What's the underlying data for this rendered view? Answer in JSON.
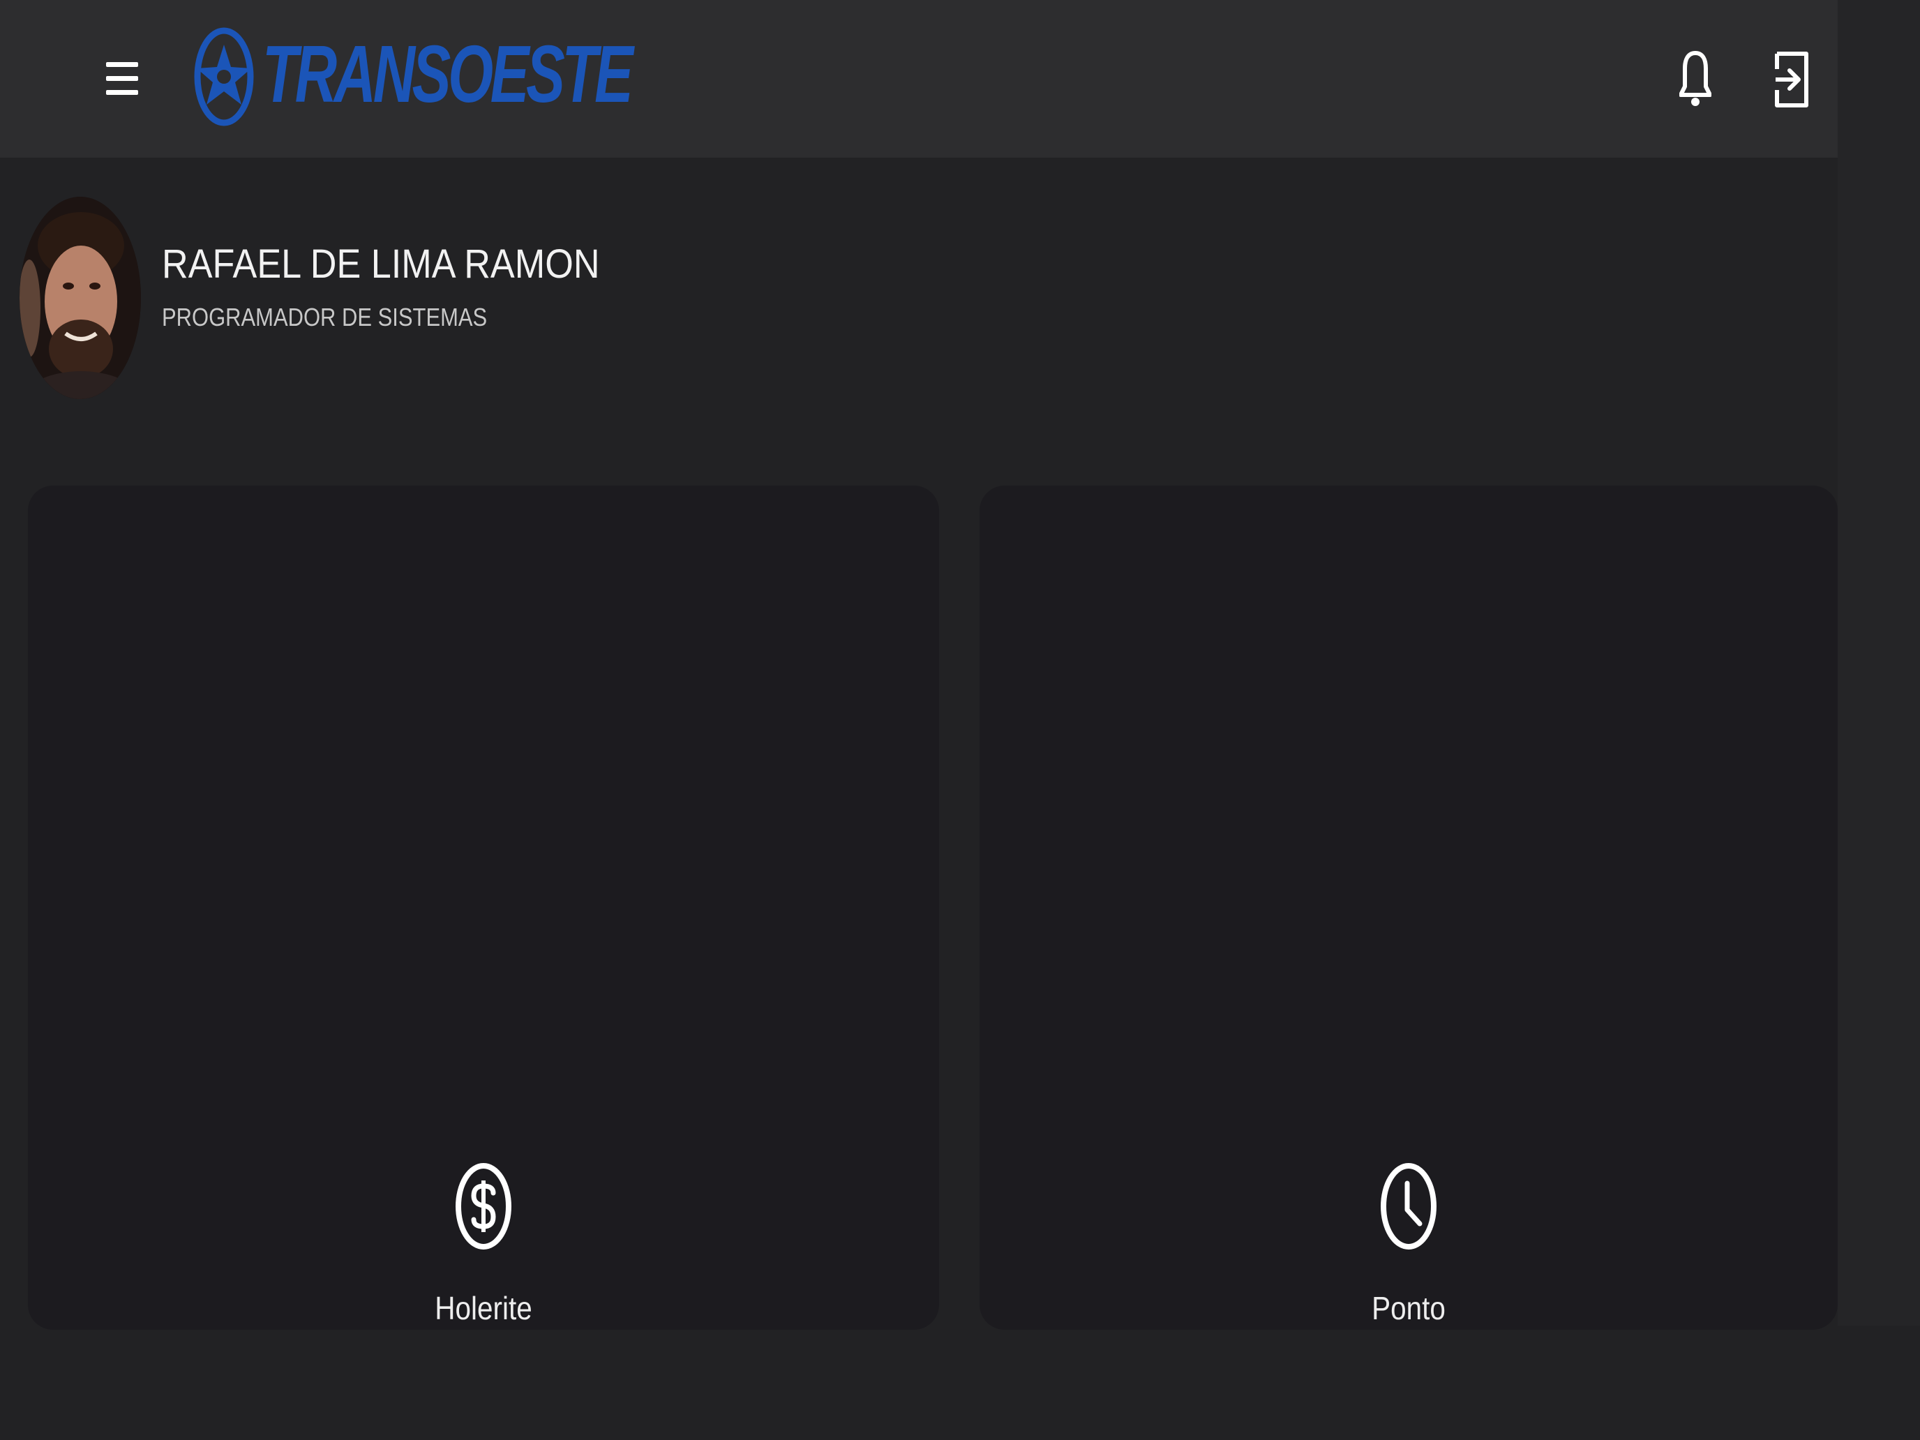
{
  "header": {
    "logo_text": "TRANSOESTE",
    "menu_icon": "hamburger-menu-icon",
    "notification_icon": "bell-icon",
    "logout_icon": "logout-icon",
    "brand_color": "#1b55b8"
  },
  "profile": {
    "name": "RAFAEL DE LIMA RAMON",
    "role": "PROGRAMADOR DE SISTEMAS"
  },
  "cards": [
    {
      "label": "Holerite",
      "icon": "dollar-circle-icon"
    },
    {
      "label": "Ponto",
      "icon": "clock-icon"
    }
  ],
  "colors": {
    "background": "#222224",
    "topbar": "#2d2d2f",
    "card": "#1c1b1f",
    "text": "#eeeeee"
  }
}
